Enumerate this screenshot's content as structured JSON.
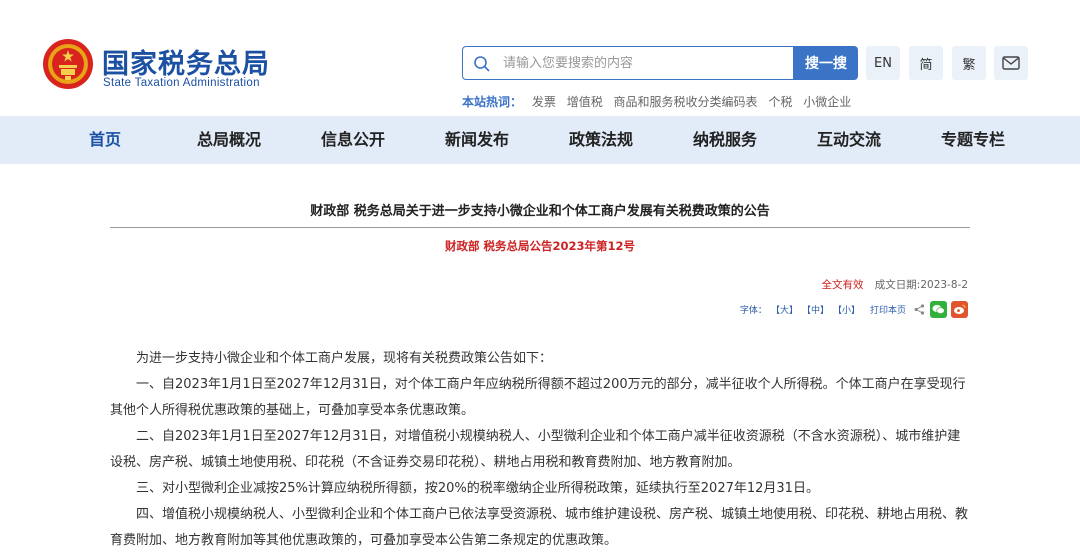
{
  "header": {
    "logo_cn": "国家税务总局",
    "logo_en": "State Taxation Administration",
    "search_placeholder": "请输入您要搜索的内容",
    "search_button": "搜一搜",
    "lang_en": "EN",
    "lang_simplified": "简",
    "lang_traditional": "繁",
    "hot_label": "本站热词：",
    "hot_words": [
      "发票",
      "增值税",
      "商品和服务税收分类编码表",
      "个税",
      "小微企业"
    ]
  },
  "nav": {
    "items": [
      "首页",
      "总局概况",
      "信息公开",
      "新闻发布",
      "政策法规",
      "纳税服务",
      "互动交流",
      "专题专栏"
    ],
    "active_index": 0
  },
  "article": {
    "title": "财政部 税务总局关于进一步支持小微企业和个体工商户发展有关税费政策的公告",
    "doc_number": "财政部 税务总局公告2023年第12号",
    "validity": "全文有效",
    "date": "成文日期:2023-8-2",
    "tools": {
      "font_label": "字体：",
      "large": "【大】",
      "medium": "【中】",
      "small": "【小】",
      "print": "打印本页"
    },
    "paragraphs": [
      "为进一步支持小微企业和个体工商户发展，现将有关税费政策公告如下：",
      "一、自2023年1月1日至2027年12月31日，对个体工商户年应纳税所得额不超过200万元的部分，减半征收个人所得税。个体工商户在享受现行其他个人所得税优惠政策的基础上，可叠加享受本条优惠政策。",
      "二、自2023年1月1日至2027年12月31日，对增值税小规模纳税人、小型微利企业和个体工商户减半征收资源税（不含水资源税）、城市维护建设税、房产税、城镇土地使用税、印花税（不含证券交易印花税）、耕地占用税和教育费附加、地方教育附加。",
      "三、对小型微利企业减按25%计算应纳税所得额，按20%的税率缴纳企业所得税政策，延续执行至2027年12月31日。",
      "四、增值税小规模纳税人、小型微利企业和个体工商户已依法享受资源税、城市维护建设税、房产税、城镇土地使用税、印花税、耕地占用税、教育费附加、地方教育附加等其他优惠政策的，可叠加享受本公告第二条规定的优惠政策。"
    ]
  },
  "colors": {
    "brand_blue": "#1b50a3",
    "button_blue": "#3b73c6",
    "nav_bg": "#e2ecf8",
    "red": "#cc2222"
  }
}
